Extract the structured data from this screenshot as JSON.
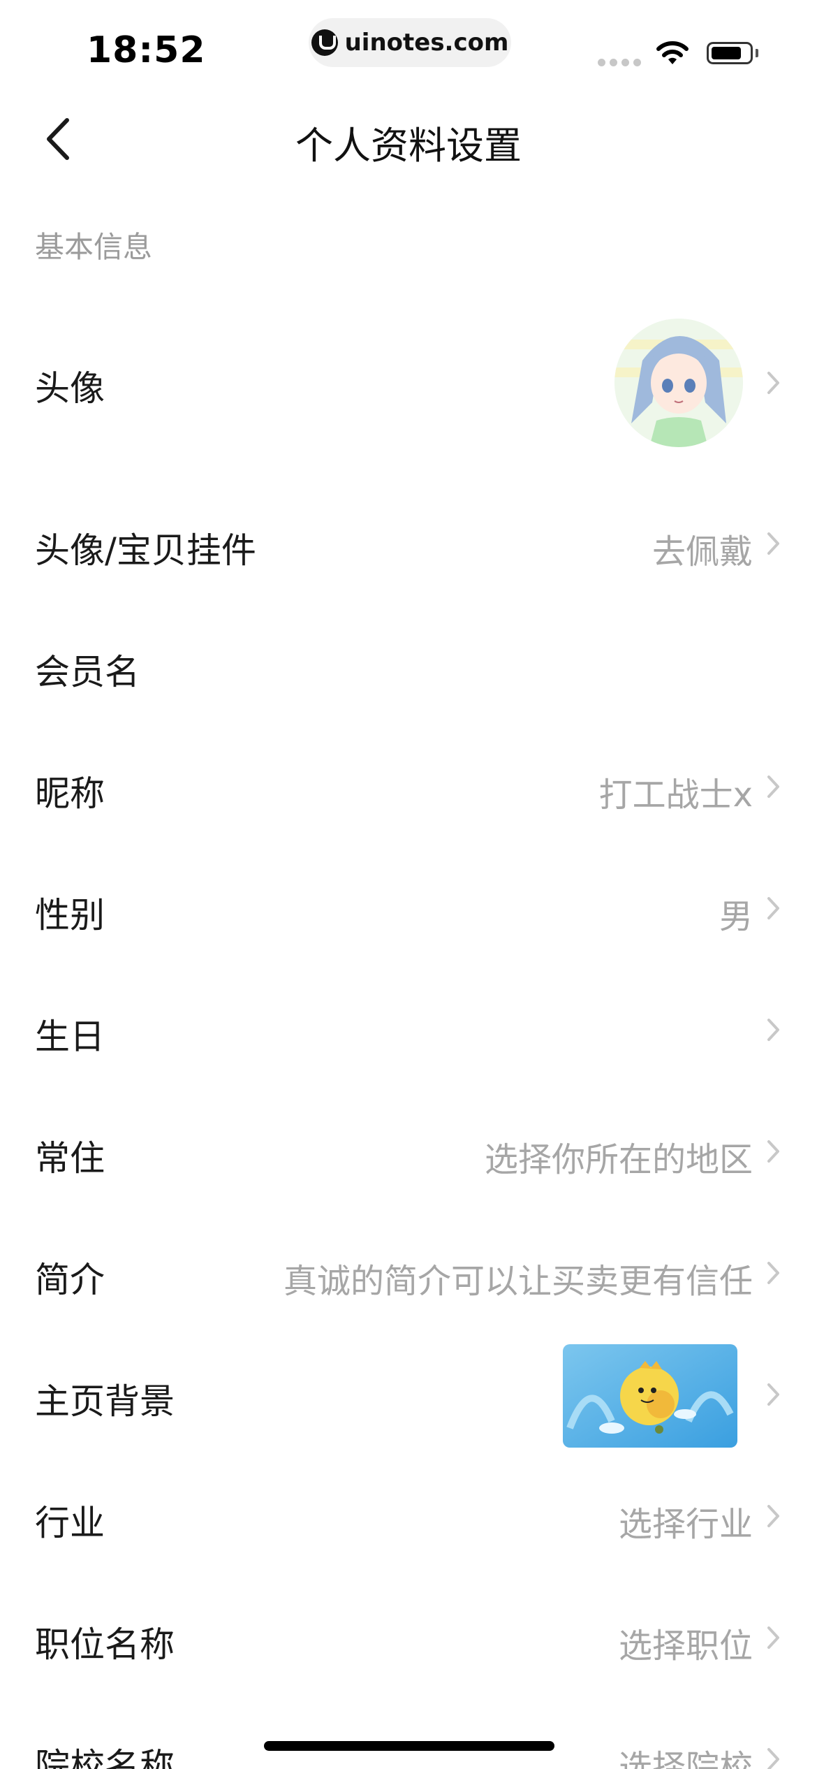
{
  "status_bar": {
    "time": "18:52",
    "url": "uinotes.com"
  },
  "nav": {
    "title": "个人资料设置"
  },
  "section": {
    "basic_info": "基本信息"
  },
  "rows": {
    "avatar": {
      "label": "头像"
    },
    "pendant": {
      "label": "头像/宝贝挂件",
      "value": "去佩戴"
    },
    "member_name": {
      "label": "会员名",
      "value": ""
    },
    "nickname": {
      "label": "昵称",
      "value": "打工战士x"
    },
    "gender": {
      "label": "性别",
      "value": "男"
    },
    "birthday": {
      "label": "生日",
      "value": ""
    },
    "residence": {
      "label": "常住",
      "value": "选择你所在的地区"
    },
    "bio": {
      "label": "简介",
      "value": "真诚的简介可以让买卖更有信任"
    },
    "homepage_bg": {
      "label": "主页背景"
    },
    "industry": {
      "label": "行业",
      "value": "选择行业"
    },
    "position": {
      "label": "职位名称",
      "value": "选择职位"
    },
    "school": {
      "label": "院校名称",
      "value": "选择院校"
    }
  },
  "colors": {
    "label": "#1a1a1a",
    "muted": "#a6a6a6",
    "section": "#9b9b9b",
    "chevron": "#c8c8c8"
  }
}
